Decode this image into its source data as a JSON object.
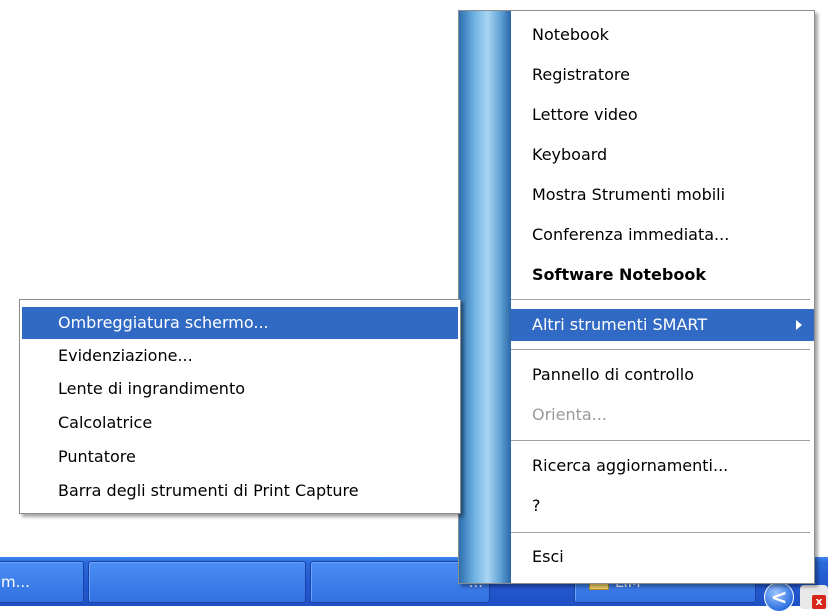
{
  "main_menu": {
    "items": [
      {
        "name": "notebook",
        "label": "Notebook"
      },
      {
        "name": "registratore",
        "label": "Registratore"
      },
      {
        "name": "lettore-video",
        "label": "Lettore video"
      },
      {
        "name": "keyboard",
        "label": "Keyboard"
      },
      {
        "name": "mostra-strumenti-mobili",
        "label": "Mostra Strumenti mobili"
      },
      {
        "name": "conferenza-immediata",
        "label": "Conferenza immediata..."
      },
      {
        "name": "software-notebook",
        "label": "Software Notebook"
      },
      {
        "name": "altri-strumenti-smart",
        "label": "Altri strumenti SMART"
      },
      {
        "name": "pannello-di-controllo",
        "label": "Pannello di controllo"
      },
      {
        "name": "orienta",
        "label": "Orienta..."
      },
      {
        "name": "ricerca-aggiornamenti",
        "label": "Ricerca aggiornamenti..."
      },
      {
        "name": "help",
        "label": "?"
      },
      {
        "name": "esci",
        "label": "Esci"
      }
    ]
  },
  "sub_menu": {
    "items": [
      {
        "name": "ombreggiatura-schermo",
        "label": "Ombreggiatura schermo..."
      },
      {
        "name": "evidenziazione",
        "label": "Evidenziazione..."
      },
      {
        "name": "lente-di-ingrandimento",
        "label": "Lente di ingrandimento"
      },
      {
        "name": "calcolatrice",
        "label": "Calcolatrice"
      },
      {
        "name": "puntatore",
        "label": "Puntatore"
      },
      {
        "name": "barra-print-capture",
        "label": "Barra degli strumenti di Print Capture"
      }
    ]
  },
  "taskbar": {
    "buttons": [
      {
        "label": "m..."
      },
      {
        "label": ""
      },
      {
        "label": "\"..."
      },
      {
        "label": "LIM"
      }
    ],
    "tray_glyph": "<",
    "tray_x": "x"
  },
  "colors": {
    "highlight": "#316ac5",
    "taskbar": "#2459d0"
  }
}
